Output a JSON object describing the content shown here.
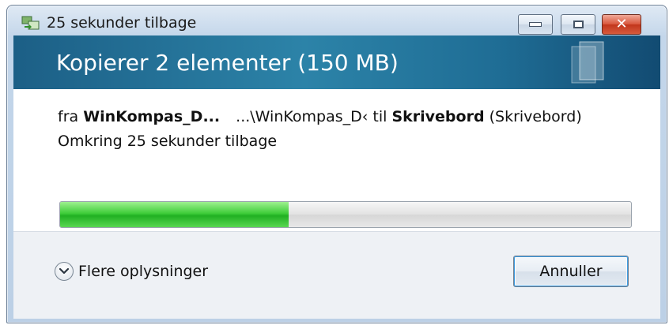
{
  "window": {
    "title": "25 sekunder tilbage",
    "controls": {
      "minimize": "minimize-icon",
      "maximize": "maximize-icon",
      "close": "close-icon"
    }
  },
  "banner": {
    "heading": "Kopierer 2 elementer (150 MB)"
  },
  "copy": {
    "from_word": "fra",
    "source_name": "WinKompas_D...",
    "source_path": "...\\WinKompas_D‹",
    "to_word": "til",
    "dest_name": "Skrivebord",
    "dest_path": "(Skrivebord)",
    "time_remaining": "Omkring 25 sekunder tilbage",
    "progress_fraction": 0.4
  },
  "footer": {
    "details_label": "Flere oplysninger",
    "cancel_label": "Annuller"
  },
  "colors": {
    "banner": "#1f6d95",
    "progress_green": "#20b022",
    "close_red": "#c2361c"
  }
}
